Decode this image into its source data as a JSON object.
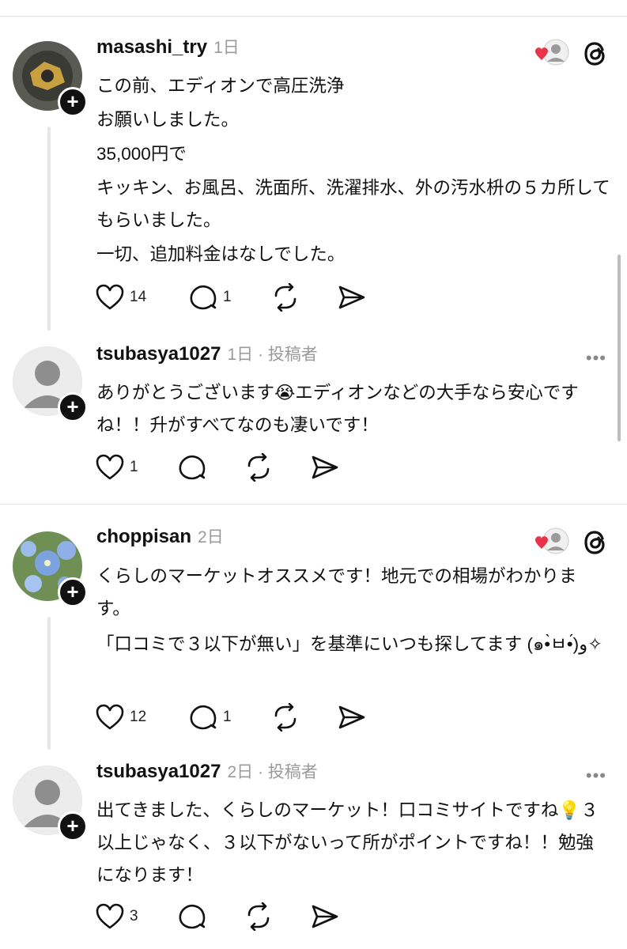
{
  "posts": [
    {
      "username": "masashi_try",
      "time": "1日",
      "lines": [
        "この前、エディオンで高圧洗浄",
        "お願いしました。",
        "35,000円で",
        "キッキン、お風呂、洗面所、洗濯排水、外の汚水枡の５カ所してもらいました。",
        "一切、追加料金はなしでした。"
      ],
      "likes": "14",
      "replies": "1"
    },
    {
      "username": "tsubasya1027",
      "time": "1日 · 投稿者",
      "lines": [
        "ありがとうございます😭エディオンなどの大手なら安心ですね！！升がすべてなのも凄いです！"
      ],
      "likes": "1",
      "replies": ""
    },
    {
      "username": "choppisan",
      "time": "2日",
      "lines": [
        "くらしのマーケットオススメです！地元での相場がわかります。",
        "「口コミで３以下が無い」を基準にいつも探してます (๑•̀ㅂ•́)و✧"
      ],
      "likes": "12",
      "replies": "1"
    },
    {
      "username": "tsubasya1027",
      "time": "2日 · 投稿者",
      "lines": [
        "出てきました、くらしのマーケット！口コミサイトですね💡３以上じゃなく、３以下がないって所がポイントですね！！勉強になります！"
      ],
      "likes": "3",
      "replies": ""
    }
  ],
  "ui": {
    "plus_glyph": "+",
    "more_glyph": "•••",
    "heart_color": "#e8334a",
    "threads_icon": "threads-logo-icon"
  }
}
